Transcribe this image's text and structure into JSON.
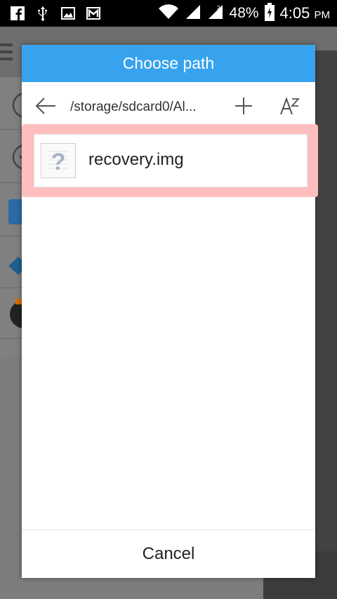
{
  "status_bar": {
    "battery": "48%",
    "time": "4:05",
    "ampm": "PM",
    "icons": [
      "facebook-icon",
      "usb-icon",
      "image-icon",
      "gmail-icon",
      "wifi-icon",
      "signal-icon",
      "signal-2-icon",
      "battery-charging-icon"
    ]
  },
  "dialog": {
    "title": "Choose path",
    "path": "/storage/sdcard0/Al...",
    "back_icon": "back-arrow-icon",
    "add_icon": "plus-icon",
    "sort_icon": "sort-az-icon",
    "files": [
      {
        "name": "recovery.img",
        "icon": "unknown-file-icon"
      }
    ],
    "cancel_label": "Cancel"
  },
  "colors": {
    "title_bar": "#37a3ee",
    "highlight": "#ffbebe",
    "status_bar": "#000000"
  }
}
